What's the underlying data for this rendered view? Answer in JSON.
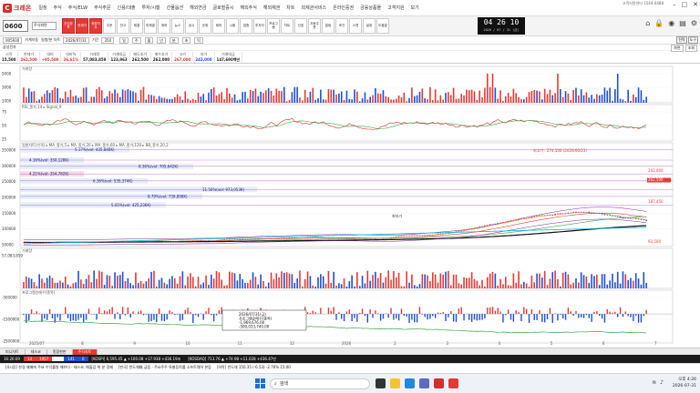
{
  "app": {
    "logo": "크레온",
    "hotline": "고객지원센터 1544-4488"
  },
  "menu": [
    "일정",
    "주식",
    "주식/ELW",
    "주식주문",
    "신용/대출",
    "투자/시황",
    "선물옵션",
    "해외연금",
    "글로벌증시",
    "해외주식",
    "해외채권",
    "차트",
    "외제관서비스",
    "온라인증권",
    "금융상품몰",
    "고객지원",
    "보기"
  ],
  "toolbar": {
    "code": "0600",
    "search_placeholder": "주식화면",
    "buttons": [
      "관심종목",
      "현재가",
      "종합차트",
      "주문",
      "잔고",
      "체결",
      "미체결",
      "계좌",
      "뉴스",
      "공시",
      "순위",
      "테마",
      "시황",
      "업종",
      "투자자",
      "프로그램",
      "차트",
      "신호",
      "자동주문",
      "알림",
      "조건",
      "스캔",
      "설정",
      "도움말"
    ]
  },
  "clock": {
    "time": "04 26 10",
    "date": "2026 / 07 / 31 (금)"
  },
  "controls": {
    "code": "005930",
    "menu": "가계자동",
    "opt": "일봉/분 차트",
    "date": "2026/07/31",
    "count_label": "기간",
    "count": "350",
    "btn_view": "전략",
    "btn_tools": "도구",
    "period_buttons": [
      "일",
      "주",
      "월",
      "년",
      "분",
      "초",
      "틱"
    ]
  },
  "options": {
    "search": "삼성전자",
    "buttons": [
      "화면",
      "조회"
    ]
  },
  "quote": {
    "headers": [
      "시작",
      "현재가",
      "대비",
      "대비%",
      "거래량",
      "거래대금",
      "매도호가",
      "매수호가",
      "고가",
      "저가",
      "거래대금"
    ],
    "values": [
      "15,500",
      "262,500",
      "+95,500",
      "26.61%",
      "57,083,859",
      "123,963",
      "262,500",
      "262,000",
      "267,000",
      "243,000",
      "147,690백만"
    ]
  },
  "chart_data": {
    "type": "line",
    "title": "삼성전자 일봉",
    "panels": [
      {
        "name": "거래량",
        "ylabels": [
          "5000",
          "3000",
          "1000"
        ]
      },
      {
        "name": "RSI_종가,14 ▸ Signal_9",
        "ylabels": [
          "75",
          "50",
          "25"
        ]
      },
      {
        "name": "일봉차트(가격) ▸ MA_종가,5 ▸ MA_종가,20 ▸ MA_종가,60 ▸ MA_종가,120 ▸ BB_종가,20,2",
        "ylabels": [
          "350000",
          "300000",
          "250000",
          "200000",
          "150000",
          "100000",
          "50000"
        ]
      },
      {
        "name": "거래량",
        "ylabels": [
          "57,083,859"
        ]
      },
      {
        "name": "프로그램순매수(종목)",
        "ylabels": [
          "-500000",
          "-1500000",
          "-2500000"
        ]
      }
    ],
    "price_levels": [
      {
        "label": "5.17%(vol: 435,846K)",
        "value": 330000
      },
      {
        "label": "4.16%(vol: 350,128K)",
        "value": 300000
      },
      {
        "label": "8.36%(vol: 705,642K)",
        "value": 282000
      },
      {
        "label": "4.21%(vol: 354,782K)",
        "value": 260000
      },
      {
        "label": "6.36%(vol: 535,374K)",
        "value": 240000
      },
      {
        "label": "11.56%(vol: 973,053K)",
        "value": 215000
      },
      {
        "label": "8.79%(vol: 739,898K)",
        "value": 195000
      },
      {
        "label": "5.05%(vol: 425,236K)",
        "value": 170000
      }
    ],
    "annotations": {
      "high": "최고가 : 274,500 (2026/06/23)",
      "low": "최저가",
      "right_labels": [
        "262,500",
        "243,000",
        "187,450",
        "93,500"
      ],
      "tooltip": [
        "2026/07/31(금)",
        "프로그램순매수(종목)",
        "-1,969,676.00",
        "-500,033,740.00"
      ]
    },
    "xaxis": [
      "2025/07",
      "8",
      "9",
      "10",
      "11",
      "12",
      "2026",
      "2",
      "3",
      "4",
      "5",
      "6",
      "7"
    ],
    "ylim": [
      50000,
      350000
    ]
  },
  "tabs": [
    "미니차트",
    "테스코",
    "종합현판",
    "주식차트"
  ],
  "ticker": [
    {
      "label": "16:26:09"
    },
    {
      "label": "14"
    },
    {
      "label": "1957"
    },
    {
      "label": "30"
    },
    {
      "label": "141"
    },
    {
      "label": "0"
    },
    {
      "label": "[KOSPI] 6,595.45 ▲ +100.08 +17.938 +436.19조"
    },
    {
      "label": "[KOSDAQ] 713.76 ▲ +74.98 +11.028 +436.47만"
    }
  ],
  "news": [
    "[4시장] 한경 매매에 주요 수익률원 패브다 · 테스코, 매출감 위 분 경제",
    "[판국] 반도체株 급등 · 주요주주 특별등락률 소프트웨어 본등",
    "[하락] 반도체 150.35 (-6.53) -2.76% 15:00"
  ],
  "taskbar": {
    "search": "검색",
    "time": "오후 4:26",
    "date": "2026-07-31"
  }
}
